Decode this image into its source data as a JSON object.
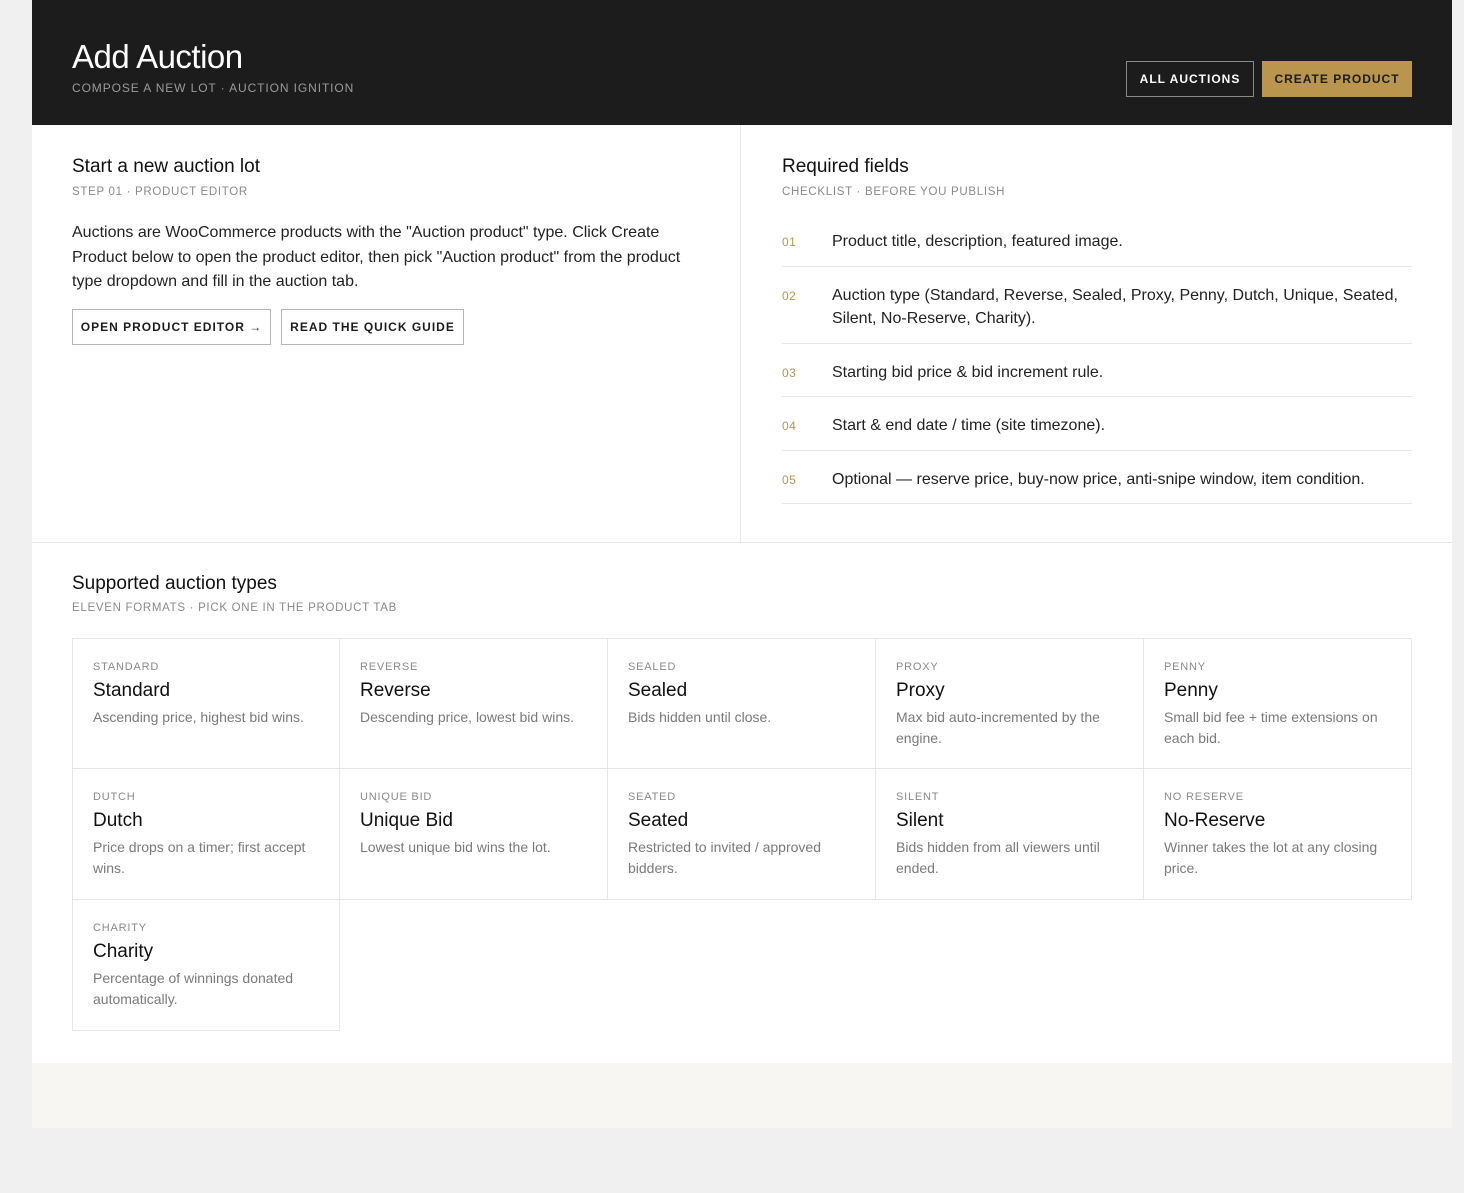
{
  "header": {
    "title": "Add Auction",
    "subtitle": "COMPOSE A NEW LOT · AUCTION IGNITION",
    "all_auctions_label": "ALL AUCTIONS",
    "create_product_label": "CREATE PRODUCT"
  },
  "start": {
    "title": "Start a new auction lot",
    "subtitle": "STEP 01 · PRODUCT EDITOR",
    "body": "Auctions are WooCommerce products with the \"Auction product\" type. Click Create Product below to open the product editor, then pick \"Auction product\" from the product type dropdown and fill in the auction tab.",
    "open_editor_label": "OPEN PRODUCT EDITOR →",
    "quick_guide_label": "READ THE QUICK GUIDE"
  },
  "required": {
    "title": "Required fields",
    "subtitle": "CHECKLIST · BEFORE YOU PUBLISH",
    "items": [
      {
        "num": "01",
        "text": "Product title, description, featured image."
      },
      {
        "num": "02",
        "text": "Auction type (Standard, Reverse, Sealed, Proxy, Penny, Dutch, Unique, Seated, Silent, No-Reserve, Charity)."
      },
      {
        "num": "03",
        "text": "Starting bid price & bid increment rule."
      },
      {
        "num": "04",
        "text": "Start & end date / time (site timezone)."
      },
      {
        "num": "05",
        "text": "Optional — reserve price, buy-now price, anti-snipe window, item condition."
      }
    ]
  },
  "types": {
    "title": "Supported auction types",
    "subtitle": "ELEVEN FORMATS · PICK ONE IN THE PRODUCT TAB",
    "items": [
      {
        "code": "STANDARD",
        "name": "Standard",
        "desc": "Ascending price, highest bid wins."
      },
      {
        "code": "REVERSE",
        "name": "Reverse",
        "desc": "Descending price, lowest bid wins."
      },
      {
        "code": "SEALED",
        "name": "Sealed",
        "desc": "Bids hidden until close."
      },
      {
        "code": "PROXY",
        "name": "Proxy",
        "desc": "Max bid auto-incremented by the engine."
      },
      {
        "code": "PENNY",
        "name": "Penny",
        "desc": "Small bid fee + time extensions on each bid."
      },
      {
        "code": "DUTCH",
        "name": "Dutch",
        "desc": "Price drops on a timer; first accept wins."
      },
      {
        "code": "UNIQUE BID",
        "name": "Unique Bid",
        "desc": "Lowest unique bid wins the lot."
      },
      {
        "code": "SEATED",
        "name": "Seated",
        "desc": "Restricted to invited / approved bidders."
      },
      {
        "code": "SILENT",
        "name": "Silent",
        "desc": "Bids hidden from all viewers until ended."
      },
      {
        "code": "NO RESERVE",
        "name": "No-Reserve",
        "desc": "Winner takes the lot at any closing price."
      },
      {
        "code": "CHARITY",
        "name": "Charity",
        "desc": "Percentage of winnings donated automatically."
      }
    ]
  },
  "colors": {
    "header_bg": "#1c1c1c",
    "accent_gold": "#b9954d",
    "page_bg": "#f0f0f0"
  }
}
